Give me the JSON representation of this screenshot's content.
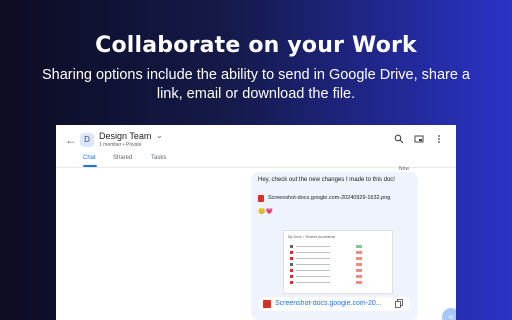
{
  "hero": {
    "title": "Collaborate on your Work",
    "subtitle": "Sharing options include the ability to send in Google Drive, share a link, email or download the file."
  },
  "chat": {
    "back_icon": "arrow-back-icon",
    "room": {
      "avatar_letter": "D",
      "name": "Design Team",
      "meta": "1 member  •  Private"
    },
    "toolbar_icons": [
      "search-icon",
      "picture-in-picture-icon",
      "more-vert-icon"
    ],
    "tabs": [
      {
        "label": "Chat",
        "active": true
      },
      {
        "label": "Shared",
        "active": false
      },
      {
        "label": "Tasks",
        "active": false
      }
    ],
    "timestamp": "Now",
    "message": {
      "text": "Hey, check out the new changes I made to this doc!",
      "attachment_name": "Screenshot-docs.google.com-20240929-1632.png",
      "reactions_label": "😊💗",
      "preview": {
        "header": "My Drive  >  Shared documents"
      },
      "file_card_name": "Screenshot-docs.google.com-20...",
      "copy_icon": "copy-icon"
    },
    "fab_icon": "chevron-double-left-icon",
    "colors": {
      "accent": "#1a73e8",
      "bubble": "#eef3fc",
      "file_red": "#d93025"
    }
  }
}
